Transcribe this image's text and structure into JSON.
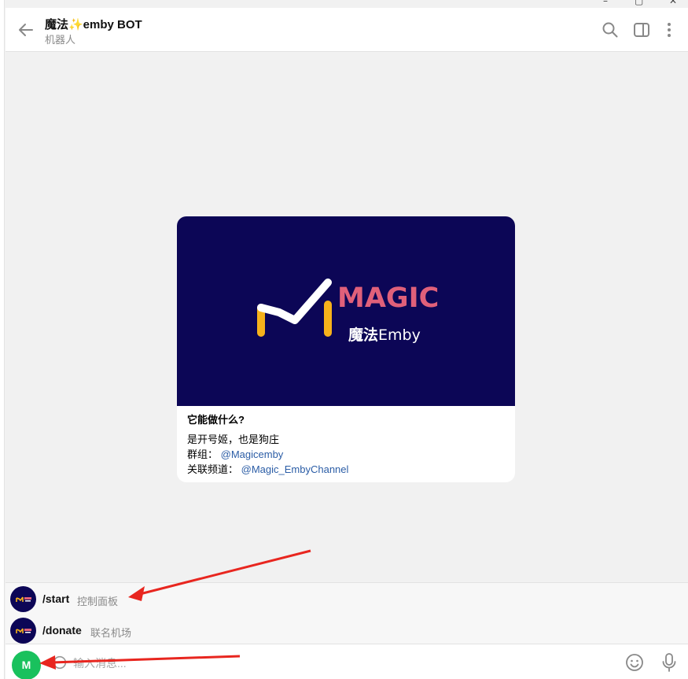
{
  "window": {
    "minimize": "–",
    "maximize": "▢",
    "close": "✕"
  },
  "header": {
    "title": "魔法✨emby BOT",
    "subtitle": "机器人"
  },
  "card": {
    "banner_brand": "MAGIC",
    "banner_sub_prefix": "魔法",
    "banner_sub_suffix": "Emby",
    "title": "它能做什么?",
    "line1": "是开号姬，也是狗庄",
    "group_label": "群组：",
    "group_link": "@Magicemby",
    "channel_label": "关联频道：",
    "channel_link": "@Magic_EmbyChannel"
  },
  "commands": [
    {
      "name": "/start",
      "desc": "控制面板"
    },
    {
      "name": "/donate",
      "desc": "联名机场"
    }
  ],
  "composer": {
    "avatar_letter": "M",
    "placeholder": "输入消息..."
  },
  "colors": {
    "banner_bg": "#0c0656",
    "brand_pink": "#e0607a",
    "logo_yellow": "#f7b21b",
    "link": "#2b5da6",
    "avatar_green": "#19c15d",
    "arrow_red": "#e8261f"
  },
  "icons": [
    "back-arrow-icon",
    "search-icon",
    "sidebar-toggle-icon",
    "more-vertical-icon",
    "attach-icon",
    "emoji-icon",
    "microphone-icon"
  ]
}
